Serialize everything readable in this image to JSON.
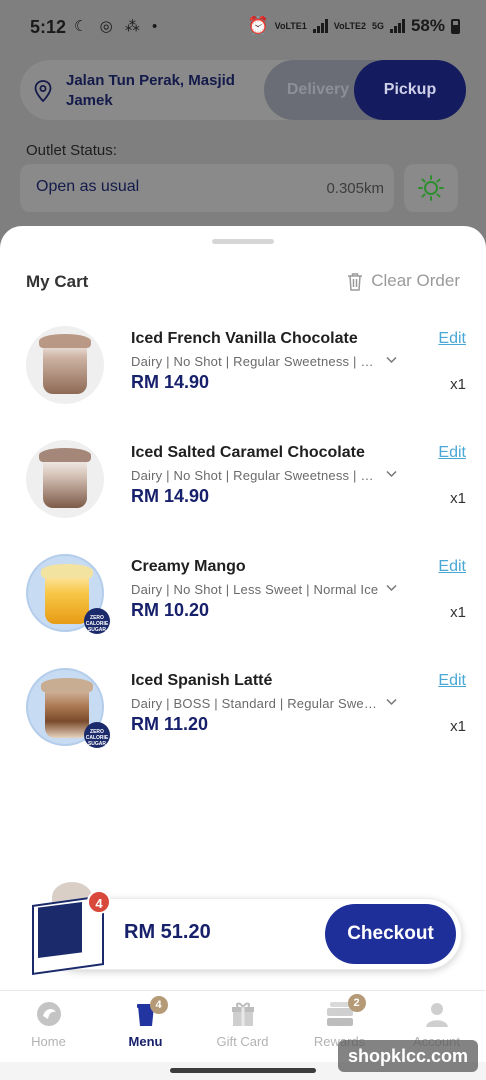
{
  "statusbar": {
    "time": "5:12",
    "left_icons": "☾ ◎ ⁂ •",
    "lte1": "VoLTE1",
    "lte2": "VoLTE2",
    "network": "5G",
    "battery": "58%"
  },
  "header": {
    "address": "Jalan Tun Perak, Masjid Jamek",
    "delivery_label": "Delivery",
    "pickup_label": "Pickup",
    "outlet_status_label": "Outlet Status:",
    "outlet_status": "Open as usual",
    "distance": "0.305km"
  },
  "cart": {
    "title": "My Cart",
    "clear_label": "Clear Order",
    "items": [
      {
        "name": "Iced French Vanilla Chocolate",
        "desc": "Dairy | No Shot | Regular Sweetness | Normal Ice",
        "price": "RM 14.90",
        "edit": "Edit",
        "qty": "x1"
      },
      {
        "name": "Iced Salted Caramel Chocolate",
        "desc": "Dairy | No Shot | Regular Sweetness | Normal Ice",
        "price": "RM 14.90",
        "edit": "Edit",
        "qty": "x1"
      },
      {
        "name": "Creamy Mango",
        "desc": "Dairy | No Shot | Less Sweet | Normal Ice",
        "price": "RM 10.20",
        "edit": "Edit",
        "qty": "x1"
      },
      {
        "name": "Iced Spanish Latté",
        "desc": "Dairy | BOSS | Standard | Regular Sweetness",
        "price": "RM 11.20",
        "edit": "Edit",
        "qty": "x1"
      }
    ],
    "zero_badge": "ZERO CALORIE SUGAR"
  },
  "checkout": {
    "count": "4",
    "total": "RM 51.20",
    "button": "Checkout"
  },
  "nav": {
    "items": [
      {
        "label": "Home",
        "icon": "home-logo-icon"
      },
      {
        "label": "Menu",
        "icon": "cup-icon",
        "badge": "4"
      },
      {
        "label": "Gift Card",
        "icon": "gift-icon"
      },
      {
        "label": "Rewards",
        "icon": "rewards-icon",
        "badge": "2"
      },
      {
        "label": "Account",
        "icon": "person-icon"
      }
    ]
  },
  "watermark": "shopklcc.com",
  "colors": {
    "brand_navy": "#17206b",
    "button_blue": "#1f2f9a",
    "edit_link": "#4aa8d6",
    "badge_red": "#d9493b"
  }
}
